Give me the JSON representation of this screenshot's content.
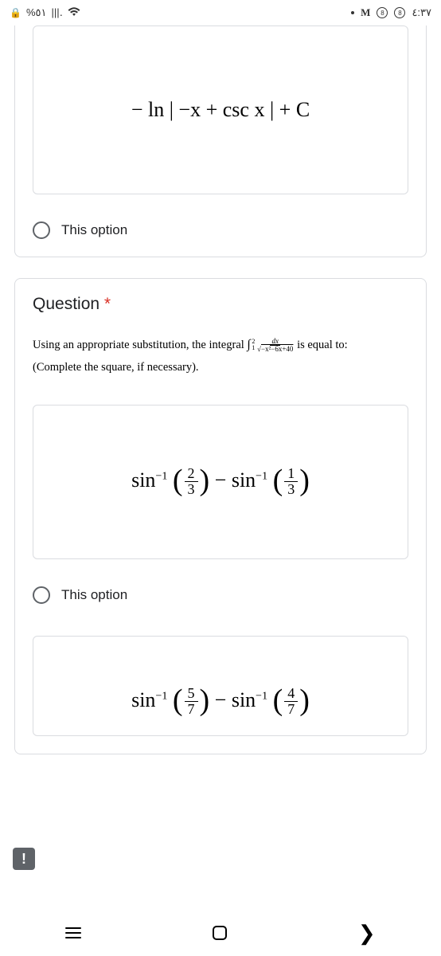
{
  "status_bar": {
    "battery": "%٥١",
    "signal": "|||․",
    "clock": "٤:٣٧"
  },
  "card1": {
    "equation": "− ln | −x + csc x | + C",
    "option_label": "This option"
  },
  "question": {
    "title": "Question",
    "required_marker": "*",
    "prompt_pre": "Using an appropriate substitution, the integral ",
    "int_lo": "1",
    "int_hi": "2",
    "frac_num": "dx",
    "frac_den_sqrt": "−x²−6x+40",
    "prompt_post": " is equal to:",
    "hint": "(Complete the square, if necessary).",
    "optA": {
      "a1n": "2",
      "a1d": "3",
      "a2n": "1",
      "a2d": "3",
      "label": "This option"
    },
    "optB": {
      "b1n": "5",
      "b1d": "7",
      "b2n": "4",
      "b2d": "7"
    }
  },
  "alert_glyph": "!"
}
